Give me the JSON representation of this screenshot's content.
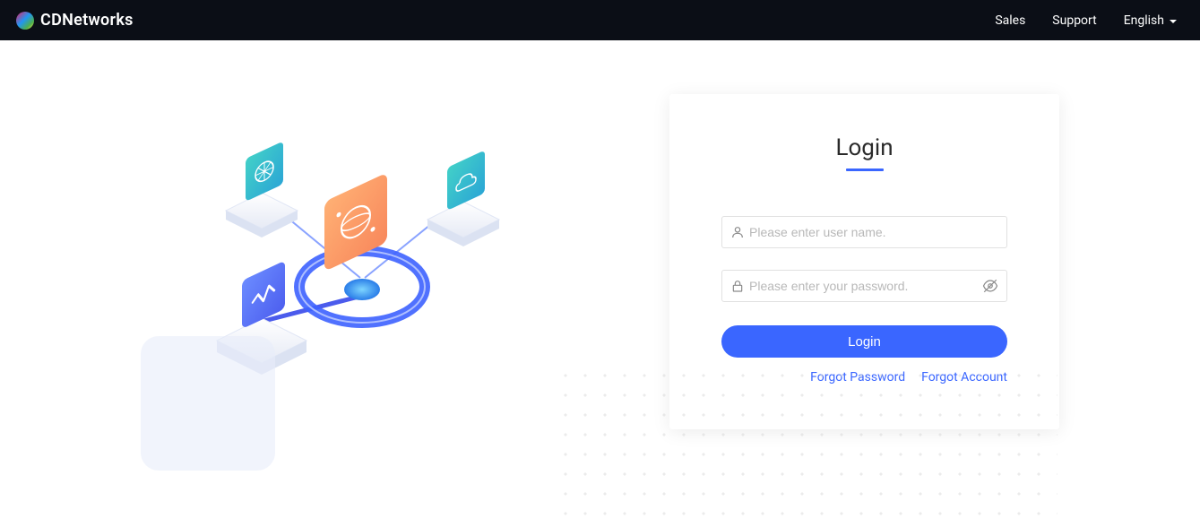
{
  "brand": {
    "name": "CDNetworks"
  },
  "nav": {
    "sales": "Sales",
    "support": "Support",
    "language": "English"
  },
  "login": {
    "title": "Login",
    "username_placeholder": "Please enter user name.",
    "password_placeholder": "Please enter your password.",
    "submit_label": "Login",
    "forgot_password": "Forgot Password",
    "forgot_account": "Forgot Account"
  }
}
